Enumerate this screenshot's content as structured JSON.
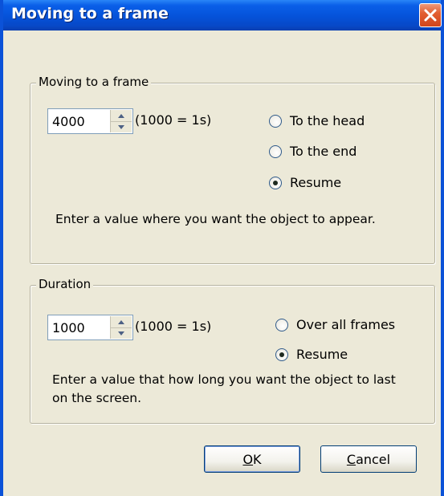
{
  "window": {
    "title": "Moving to a frame",
    "close_icon": "close-icon"
  },
  "frame_group": {
    "legend": "Moving to a frame",
    "spin_value": "4000",
    "unit_hint": "(1000 = 1s)",
    "options": [
      {
        "label": "To the head",
        "checked": false
      },
      {
        "label": "To the end",
        "checked": false
      },
      {
        "label": "Resume",
        "checked": true
      }
    ],
    "instruction": "Enter a value where you want the object to appear."
  },
  "duration_group": {
    "legend": "Duration",
    "spin_value": "1000",
    "unit_hint": "(1000 = 1s)",
    "options": [
      {
        "label": "Over all frames",
        "checked": false
      },
      {
        "label": "Resume",
        "checked": true
      }
    ],
    "instruction": "Enter a value that how long you want the object to last on the screen."
  },
  "buttons": {
    "ok_label": "OK",
    "ok_mnemonic": "O",
    "ok_rest": "K",
    "cancel_label": "Cancel",
    "cancel_mnemonic": "C",
    "cancel_rest": "ancel"
  },
  "colors": {
    "titlebar": "#0552d9",
    "dialog_bg": "#ece9d8",
    "close_button": "#e25f32"
  }
}
